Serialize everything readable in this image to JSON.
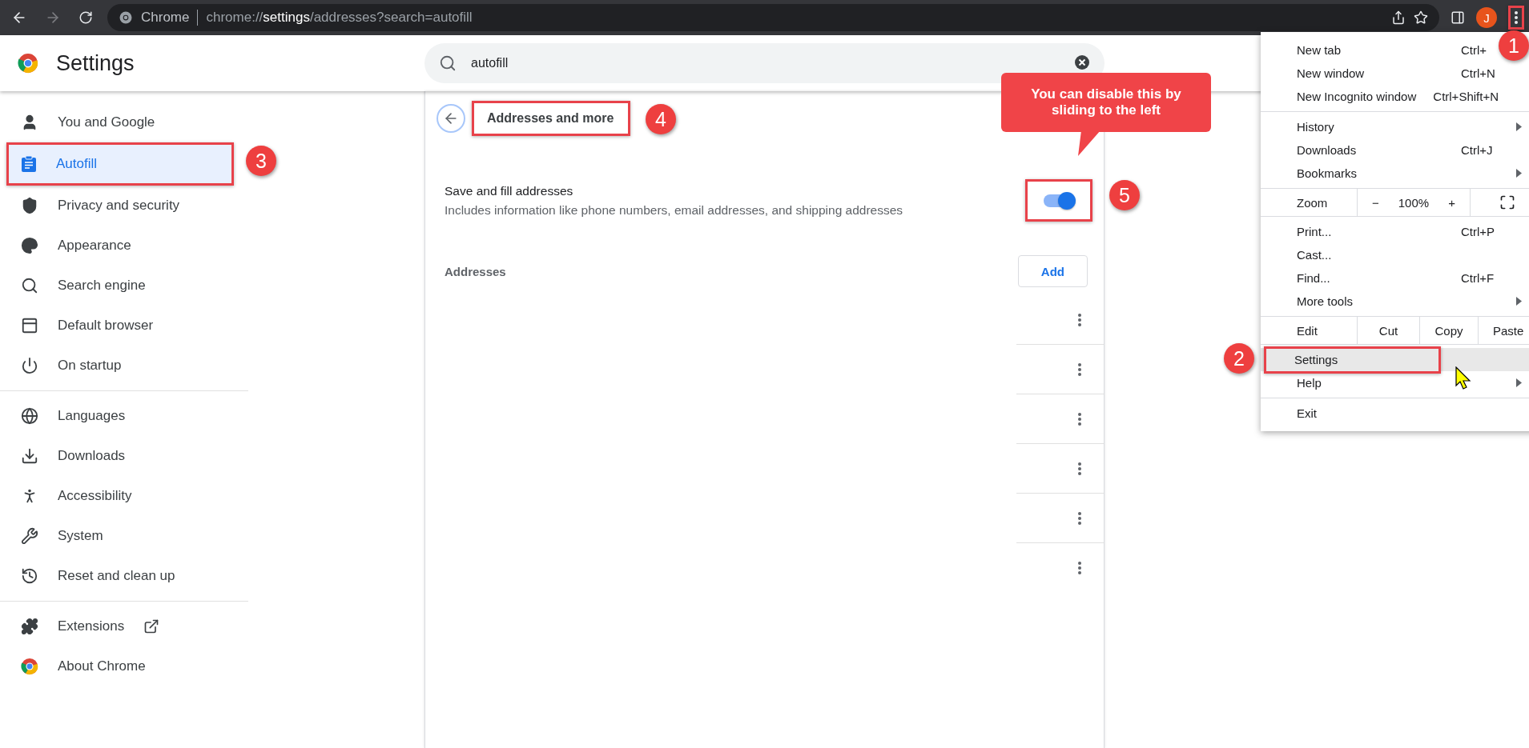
{
  "browser": {
    "site_label": "Chrome",
    "url_parts": [
      {
        "text": "chrome://",
        "emphasized": false
      },
      {
        "text": "settings",
        "emphasized": true
      },
      {
        "text": "/addresses?search=autofill",
        "emphasized": false
      }
    ],
    "avatar": "J"
  },
  "header": {
    "title": "Settings",
    "search": {
      "value": "autofill"
    }
  },
  "sidebar": {
    "groups": [
      {
        "items": [
          {
            "label": "You and Google",
            "selected": false
          },
          {
            "label": "Autofill",
            "selected": true
          },
          {
            "label": "Privacy and security",
            "selected": false
          },
          {
            "label": "Appearance",
            "selected": false
          },
          {
            "label": "Search engine",
            "selected": false
          },
          {
            "label": "Default browser",
            "selected": false
          },
          {
            "label": "On startup",
            "selected": false
          }
        ]
      },
      {
        "items": [
          {
            "label": "Languages",
            "selected": false
          },
          {
            "label": "Downloads",
            "selected": false
          },
          {
            "label": "Accessibility",
            "selected": false
          },
          {
            "label": "System",
            "selected": false
          },
          {
            "label": "Reset and clean up",
            "selected": false
          }
        ]
      },
      {
        "items": [
          {
            "label": "Extensions",
            "selected": false
          },
          {
            "label": "About Chrome",
            "selected": false
          }
        ]
      }
    ]
  },
  "page": {
    "title": "Addresses and more",
    "setting": {
      "label": "Save and fill addresses",
      "description": "Includes information like phone numbers, email addresses, and shipping addresses",
      "on": true
    },
    "addresses": {
      "label": "Addresses",
      "add_button": "Add",
      "rows": [
        {
          "kind": "entry"
        },
        {
          "kind": "entry"
        },
        {
          "kind": "entry"
        },
        {
          "kind": "entry"
        },
        {
          "kind": "entry"
        },
        {
          "kind": "entry"
        }
      ]
    }
  },
  "menu": {
    "sections": [
      {
        "kind": "items",
        "items": [
          {
            "label": "New tab",
            "shortcut": "Ctrl+",
            "submenu": false,
            "selected": false
          },
          {
            "label": "New window",
            "shortcut": "Ctrl+N",
            "submenu": false,
            "selected": false
          },
          {
            "label": "New Incognito window",
            "shortcut": "Ctrl+Shift+N",
            "submenu": false,
            "selected": false
          }
        ]
      },
      {
        "kind": "items",
        "items": [
          {
            "label": "History",
            "submenu": true,
            "selected": false
          },
          {
            "label": "Downloads",
            "shortcut": "Ctrl+J",
            "submenu": false,
            "selected": false
          },
          {
            "label": "Bookmarks",
            "submenu": true,
            "selected": false
          }
        ]
      },
      {
        "kind": "zoom",
        "label": "Zoom",
        "minus": "−",
        "value": "100%",
        "plus": "+"
      },
      {
        "kind": "items",
        "items": [
          {
            "label": "Print...",
            "shortcut": "Ctrl+P",
            "submenu": false,
            "selected": false
          },
          {
            "label": "Cast...",
            "submenu": false,
            "selected": false
          },
          {
            "label": "Find...",
            "shortcut": "Ctrl+F",
            "submenu": false,
            "selected": false
          },
          {
            "label": "More tools",
            "submenu": true,
            "selected": false
          }
        ]
      },
      {
        "kind": "edit",
        "label": "Edit",
        "actions": [
          "Cut",
          "Copy",
          "Paste"
        ]
      },
      {
        "kind": "items",
        "items": [
          {
            "label": "Settings",
            "submenu": false,
            "selected": true
          },
          {
            "label": "Help",
            "submenu": true,
            "selected": false
          }
        ]
      },
      {
        "kind": "items",
        "items": [
          {
            "label": "Exit",
            "submenu": false,
            "selected": false
          }
        ]
      }
    ]
  },
  "annotations": {
    "markers": [
      {
        "label": "1"
      },
      {
        "label": "2"
      },
      {
        "label": "3"
      },
      {
        "label": "4"
      },
      {
        "label": "5"
      }
    ],
    "callout": {
      "text": "You can disable this by sliding to the left"
    }
  }
}
